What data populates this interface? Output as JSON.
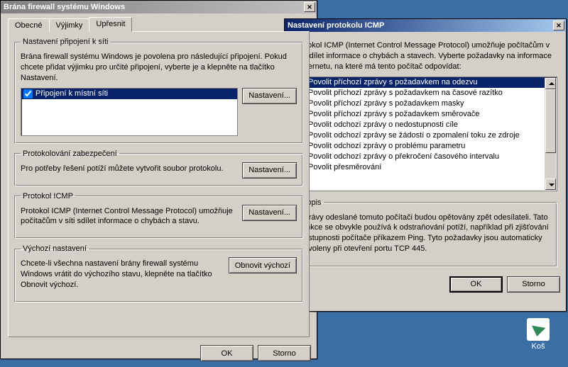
{
  "desktop": {
    "trash_label": "Koš"
  },
  "main_window": {
    "title": "Brána firewall systému Windows",
    "tabs": {
      "general": "Obecné",
      "exceptions": "Výjimky",
      "advanced": "Upřesnit"
    },
    "network": {
      "legend": "Nastavení připojení k síti",
      "desc": "Brána firewall systému Windows je povolena pro následující připojení. Pokud chcete přidat výjimku pro určité připojení, vyberte je a klepněte na tlačítko Nastavení.",
      "item0": "Připojení k místní síti",
      "btn": "Nastavení..."
    },
    "logging": {
      "legend": "Protokolování zabezpečení",
      "desc": "Pro potřeby řešení potíží můžete vytvořit soubor protokolu.",
      "btn": "Nastavení..."
    },
    "icmp": {
      "legend": "Protokol ICMP",
      "desc": "Protokol ICMP (Internet Control Message Protocol) umožňuje počítačům v síti sdílet informace o chybách a stavu.",
      "btn": "Nastavení..."
    },
    "defaults": {
      "legend": "Výchozí nastavení",
      "desc": "Chcete-li všechna nastavení brány firewall systému Windows vrátit do výchozího stavu, klepněte na tlačítko Obnovit výchozí.",
      "btn": "Obnovit výchozí"
    },
    "ok": "OK",
    "cancel": "Storno"
  },
  "icmp_dialog": {
    "title": "Nastavení protokolu ICMP",
    "intro": "Protokol ICMP (Internet Control Message Protocol) umožňuje počítačům v síti sdílet informace o chybách a stavech. Vyberte požadavky na informace z Internetu, na které má tento počítač odpovídat:",
    "items": {
      "i0": "Povolit příchozí zprávy s požadavkem na odezvu",
      "i1": "Povolit příchozí zprávy s požadavkem na časové razítko",
      "i2": "Povolit příchozí zprávy s požadavkem masky",
      "i3": "Povolit příchozí zprávy s požadavkem směrovače",
      "i4": "Povolit odchozí zprávy o nedostupnosti cíle",
      "i5": "Povolit odchozí zprávy se žádostí o zpomalení toku ze zdroje",
      "i6": "Povolit odchozí zprávy o problému parametru",
      "i7": "Povolit odchozí zprávy o překročení časového intervalu",
      "i8": "Povolit přesměrování"
    },
    "popis_legend": "Popis",
    "popis_text": "Zprávy odeslané tomuto počítači budou opětovány zpět odesílateli. Tato funkce se obvykle používá k odstraňování potíží, například při zjišťování dostupnosti počítače příkazem Ping. Tyto požadavky jsou automaticky povoleny při otevření portu TCP 445.",
    "ok": "OK",
    "cancel": "Storno"
  }
}
